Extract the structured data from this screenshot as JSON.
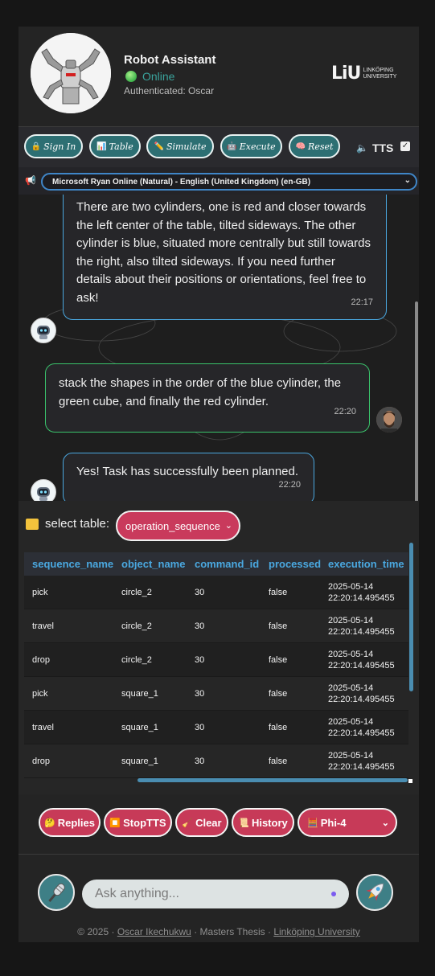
{
  "header": {
    "title": "Robot Assistant",
    "status": "Online",
    "auth": "Authenticated: Oscar",
    "logo_mark": "LiU",
    "logo_text_1": "LINKÖPING",
    "logo_text_2": "UNIVERSITY"
  },
  "toolbar": {
    "buttons": [
      {
        "label": "Sign In",
        "icon": "lock-icon"
      },
      {
        "label": "Table",
        "icon": "chart-icon"
      },
      {
        "label": "Simulate",
        "icon": "pencil-icon"
      },
      {
        "label": "Execute",
        "icon": "robot-icon"
      },
      {
        "label": "Reset",
        "icon": "brain-icon"
      }
    ],
    "tts_label": "TTS",
    "tts_checked": true
  },
  "voice": {
    "selected": "Microsoft Ryan Online (Natural) - English (United Kingdom) (en-GB)"
  },
  "chat": {
    "messages": [
      {
        "role": "bot",
        "text": "There are two cylinders, one is red and closer towards the left center of the table, tilted sideways. The other cylinder is blue, situated more centrally but still towards the right, also tilted sideways. If you need further details about their positions or orientations, feel free to ask!",
        "time": "22:17"
      },
      {
        "role": "user",
        "text": "stack the shapes in the order of the blue cylinder, the green cube, and finally the red cylinder.",
        "time": "22:20"
      },
      {
        "role": "bot",
        "text": "Yes! Task has successfully been planned.",
        "time": "22:20"
      }
    ]
  },
  "table_section": {
    "label": "select table:",
    "selected_table": "operation_sequence",
    "columns": [
      "sequence_name",
      "object_name",
      "command_id",
      "processed",
      "execution_time"
    ],
    "rows": [
      [
        "pick",
        "circle_2",
        "30",
        "false",
        "2025-05-14 22:20:14.495455"
      ],
      [
        "travel",
        "circle_2",
        "30",
        "false",
        "2025-05-14 22:20:14.495455"
      ],
      [
        "drop",
        "circle_2",
        "30",
        "false",
        "2025-05-14 22:20:14.495455"
      ],
      [
        "pick",
        "square_1",
        "30",
        "false",
        "2025-05-14 22:20:14.495455"
      ],
      [
        "travel",
        "square_1",
        "30",
        "false",
        "2025-05-14 22:20:14.495455"
      ],
      [
        "drop",
        "square_1",
        "30",
        "false",
        "2025-05-14 22:20:14.495455"
      ]
    ]
  },
  "actions": {
    "replies": "Replies",
    "stop_tts": "StopTTS",
    "clear": "Clear",
    "history": "History",
    "model": "Phi-4"
  },
  "input": {
    "placeholder": "Ask anything..."
  },
  "footer": {
    "prefix": "© 2025 · ",
    "author": "Oscar Ikechukwu",
    "middle": " · Masters Thesis · ",
    "university": "Linköping University"
  },
  "colors": {
    "teal": "#2d6f73",
    "pink": "#c73a58",
    "accent_blue": "#4aa8e0",
    "online_green": "#3db24a"
  }
}
